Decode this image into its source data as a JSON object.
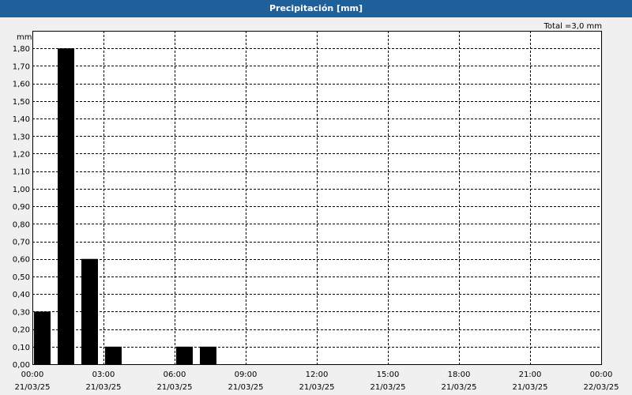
{
  "window": {
    "title": "Precipitación [mm]"
  },
  "chart_data": {
    "type": "bar",
    "ylabel": "mm",
    "total_label": "Total =3,0 mm",
    "ylim": [
      0,
      1.9
    ],
    "yticks": [
      "0,00",
      "0,10",
      "0,20",
      "0,30",
      "0,40",
      "0,50",
      "0,60",
      "0,70",
      "0,80",
      "0,90",
      "1,00",
      "1,10",
      "1,20",
      "1,30",
      "1,40",
      "1,50",
      "1,60",
      "1,70",
      "1,80"
    ],
    "xticks": [
      {
        "time": "00:00",
        "date": "21/03/25"
      },
      {
        "time": "03:00",
        "date": "21/03/25"
      },
      {
        "time": "06:00",
        "date": "21/03/25"
      },
      {
        "time": "09:00",
        "date": "21/03/25"
      },
      {
        "time": "12:00",
        "date": "21/03/25"
      },
      {
        "time": "15:00",
        "date": "21/03/25"
      },
      {
        "time": "18:00",
        "date": "21/03/25"
      },
      {
        "time": "21:00",
        "date": "21/03/25"
      },
      {
        "time": "00:00",
        "date": "22/03/25"
      }
    ],
    "x_range_hours": [
      0,
      24
    ],
    "bars": [
      {
        "hour": 0,
        "value": 0.3
      },
      {
        "hour": 1,
        "value": 1.8
      },
      {
        "hour": 2,
        "value": 0.6
      },
      {
        "hour": 3,
        "value": 0.1
      },
      {
        "hour": 4,
        "value": 0
      },
      {
        "hour": 5,
        "value": 0
      },
      {
        "hour": 6,
        "value": 0.1
      },
      {
        "hour": 7,
        "value": 0.1
      },
      {
        "hour": 8,
        "value": 0
      },
      {
        "hour": 9,
        "value": 0
      },
      {
        "hour": 10,
        "value": 0
      },
      {
        "hour": 11,
        "value": 0
      },
      {
        "hour": 12,
        "value": 0
      },
      {
        "hour": 13,
        "value": 0
      },
      {
        "hour": 14,
        "value": 0
      },
      {
        "hour": 15,
        "value": 0
      },
      {
        "hour": 16,
        "value": 0
      },
      {
        "hour": 17,
        "value": 0
      },
      {
        "hour": 18,
        "value": 0
      },
      {
        "hour": 19,
        "value": 0
      },
      {
        "hour": 20,
        "value": 0
      },
      {
        "hour": 21,
        "value": 0
      },
      {
        "hour": 22,
        "value": 0
      },
      {
        "hour": 23,
        "value": 0
      }
    ],
    "bar_color": "#000000",
    "grid": true
  }
}
